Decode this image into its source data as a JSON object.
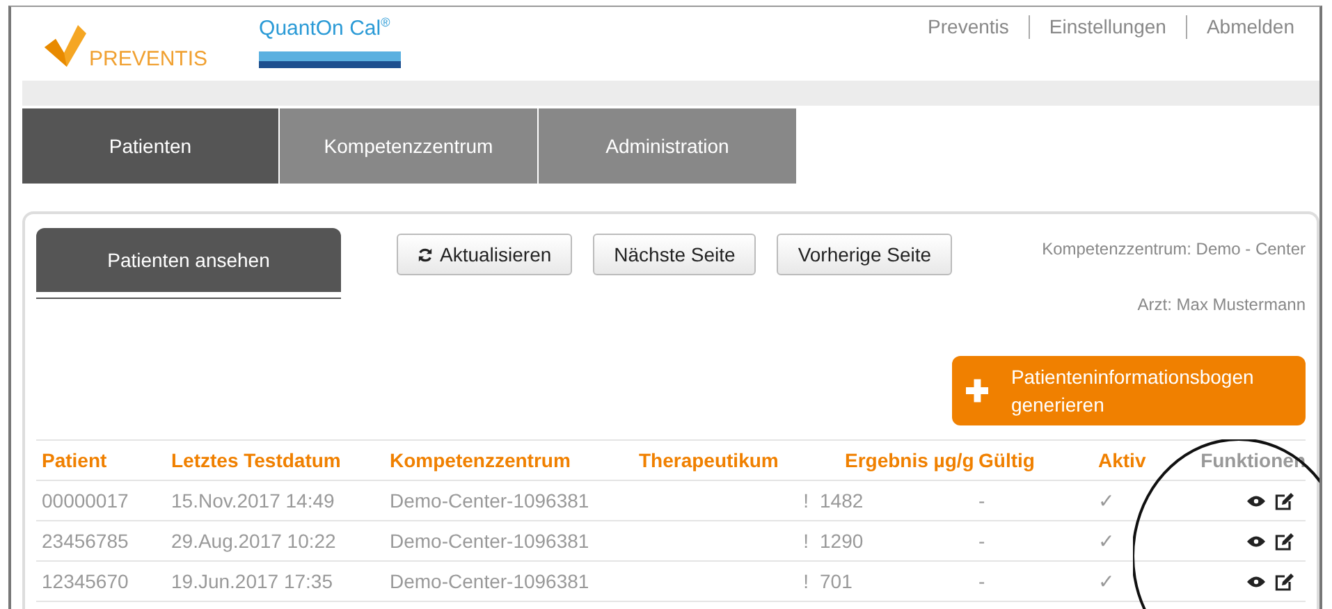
{
  "header": {
    "brand": "PREVENTIS",
    "product": "QuantOn Cal$^{®}$",
    "links": [
      "Preventis",
      "Einstellungen",
      "Abmelden"
    ]
  },
  "tabs": [
    {
      "label": "Patienten",
      "selected": true
    },
    {
      "label": "Kompetenzzentrum",
      "selected": false
    },
    {
      "label": "Administration",
      "selected": false
    }
  ],
  "subtabs": [
    {
      "label": "Patienten ansehen",
      "selected": true
    }
  ],
  "toolbar": [
    {
      "label": "Aktualisieren",
      "kind": "refresh"
    },
    {
      "label": "Nächste Seite",
      "kind": "plain"
    },
    {
      "label": "Vorherige Seite",
      "kind": "plain"
    }
  ],
  "info": [
    "Kompetenzzentrum: Demo - Center",
    "Arzt: Max Mustermann"
  ],
  "action_button": {
    "label": "Patienteninformationsbogen generieren"
  },
  "table": {
    "columns": [
      {
        "label": "Patient",
        "muted": false
      },
      {
        "label": "Letztes Testdatum",
        "muted": false
      },
      {
        "label": "Kompetenzzentrum",
        "muted": false
      },
      {
        "label": "Therapeutikum",
        "muted": false
      },
      {
        "label": "Ergebnis µg/g",
        "muted": false
      },
      {
        "label": "Gültig",
        "muted": false
      },
      {
        "label": "Aktiv",
        "muted": false
      },
      {
        "label": "Funktionen",
        "muted": true
      }
    ],
    "rows": [
      {
        "patient": "00000017",
        "date": "15.Nov.2017 14:49",
        "center": "Demo-Center-1096381",
        "flag": "!",
        "result": "1482",
        "valid": "-",
        "active": "✓"
      },
      {
        "patient": "23456785",
        "date": "29.Aug.2017 10:22",
        "center": "Demo-Center-1096381",
        "flag": "!",
        "result": "1290",
        "valid": "-",
        "active": "✓"
      },
      {
        "patient": "12345670",
        "date": "19.Jun.2017 17:35",
        "center": "Demo-Center-1096381",
        "flag": "!",
        "result": "701",
        "valid": "-",
        "active": "✓"
      }
    ]
  },
  "annotation": {
    "kind": "circle"
  }
}
